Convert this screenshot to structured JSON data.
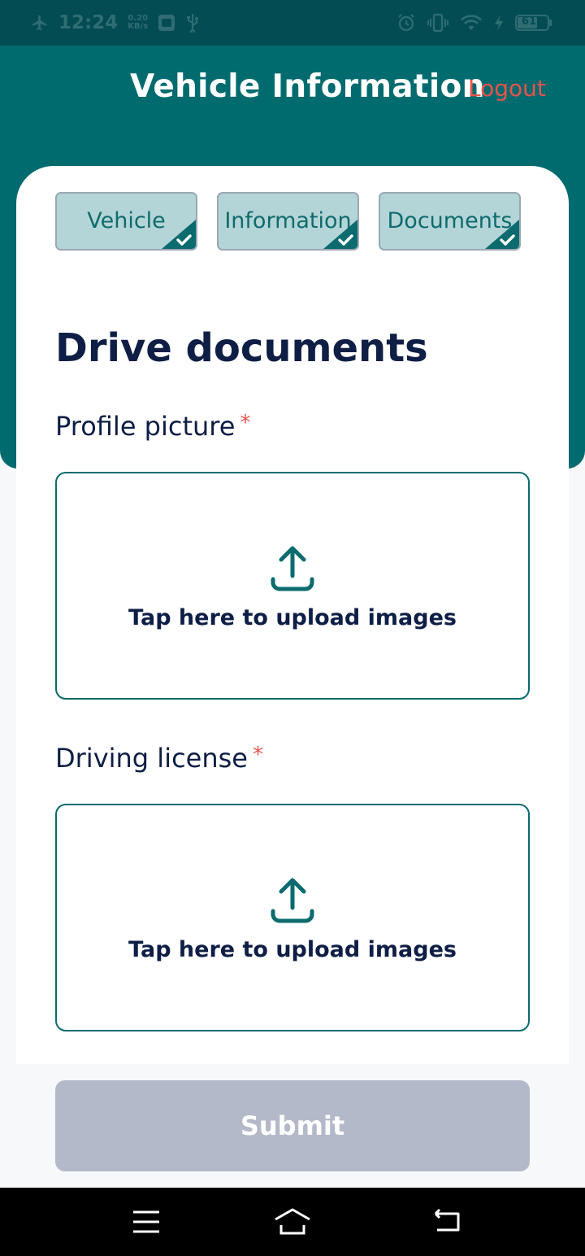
{
  "status_bar": {
    "time": "12:24",
    "net_speed_value": "0.20",
    "net_speed_unit": "KB/s",
    "battery": "61",
    "icons": [
      "airplane-icon",
      "vpn-icon",
      "usb-icon",
      "alarm-icon",
      "vibrate-icon",
      "wifi-icon",
      "charging-icon",
      "battery-icon"
    ]
  },
  "header": {
    "title": "Vehicle Information",
    "logout_label": "Logout"
  },
  "steps": [
    {
      "label": "Vehicle",
      "completed": true
    },
    {
      "label": "Information",
      "completed": true
    },
    {
      "label": "Documents",
      "completed": true
    }
  ],
  "section": {
    "title": "Drive documents"
  },
  "fields": [
    {
      "label": "Profile picture",
      "required_mark": "*",
      "upload_text": "Tap here to upload images"
    },
    {
      "label": "Driving license",
      "required_mark": "*",
      "upload_text": "Tap here to upload images"
    }
  ],
  "submit_label": "Submit",
  "nav": {
    "icons": [
      "menu-icon",
      "home-icon",
      "back-icon"
    ]
  },
  "colors": {
    "primary": "#006b6e",
    "status_bar": "#044c54",
    "accent_red": "#e8534d",
    "text_dark": "#0e1e45",
    "step_bg": "#b4d5d7",
    "submit_disabled": "#b3b9c9"
  }
}
